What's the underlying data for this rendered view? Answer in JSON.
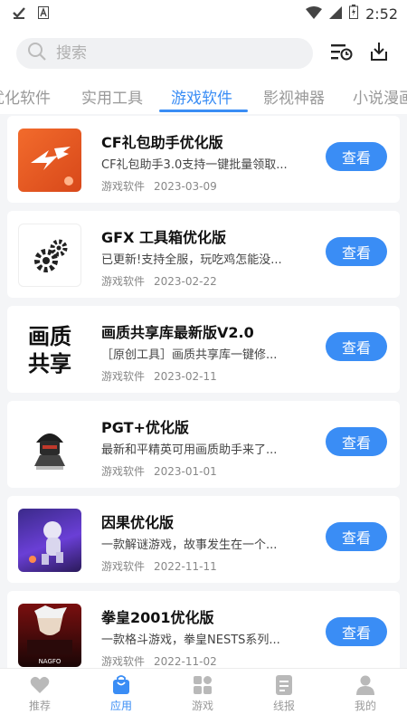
{
  "status_bar": {
    "time": "2:52"
  },
  "search": {
    "placeholder": "搜索"
  },
  "tabs": [
    {
      "label": "优化软件"
    },
    {
      "label": "实用工具"
    },
    {
      "label": "游戏软件",
      "active": true
    },
    {
      "label": "影视神器"
    },
    {
      "label": "小说漫画"
    }
  ],
  "apps": [
    {
      "title": "CF礼包助手优化版",
      "desc": "CF礼包助手3.0支持一键批量领取...",
      "category": "游戏软件",
      "date": "2023-03-09",
      "button": "查看"
    },
    {
      "title": "GFX 工具箱优化版",
      "desc": "已更新!支持全服，玩吃鸡怎能没...",
      "category": "游戏软件",
      "date": "2023-02-22",
      "button": "查看"
    },
    {
      "title": "画质共享库最新版V2.0",
      "desc": "［原创工具］画质共享库一键修...",
      "category": "游戏软件",
      "date": "2023-02-11",
      "button": "查看",
      "thumb_text": [
        "画质",
        "共享"
      ]
    },
    {
      "title": "PGT+优化版",
      "desc": "最新和平精英可用画质助手来了...",
      "category": "游戏软件",
      "date": "2023-01-01",
      "button": "查看"
    },
    {
      "title": "因果优化版",
      "desc": "一款解谜游戏，故事发生在一个...",
      "category": "游戏软件",
      "date": "2022-11-11",
      "button": "查看"
    },
    {
      "title": "拳皇2001优化版",
      "desc": "一款格斗游戏，拳皇NESTS系列...",
      "category": "游戏软件",
      "date": "2022-11-02",
      "button": "查看",
      "thumb_text": [
        "NAGFO"
      ]
    }
  ],
  "bottom_nav": [
    {
      "label": "推荐",
      "icon": "heart-icon"
    },
    {
      "label": "应用",
      "icon": "bag-icon",
      "active": true
    },
    {
      "label": "游戏",
      "icon": "grid-icon"
    },
    {
      "label": "线报",
      "icon": "news-icon"
    },
    {
      "label": "我的",
      "icon": "user-icon"
    }
  ],
  "colors": {
    "accent": "#3a8df5",
    "background": "#f4f5f7"
  }
}
